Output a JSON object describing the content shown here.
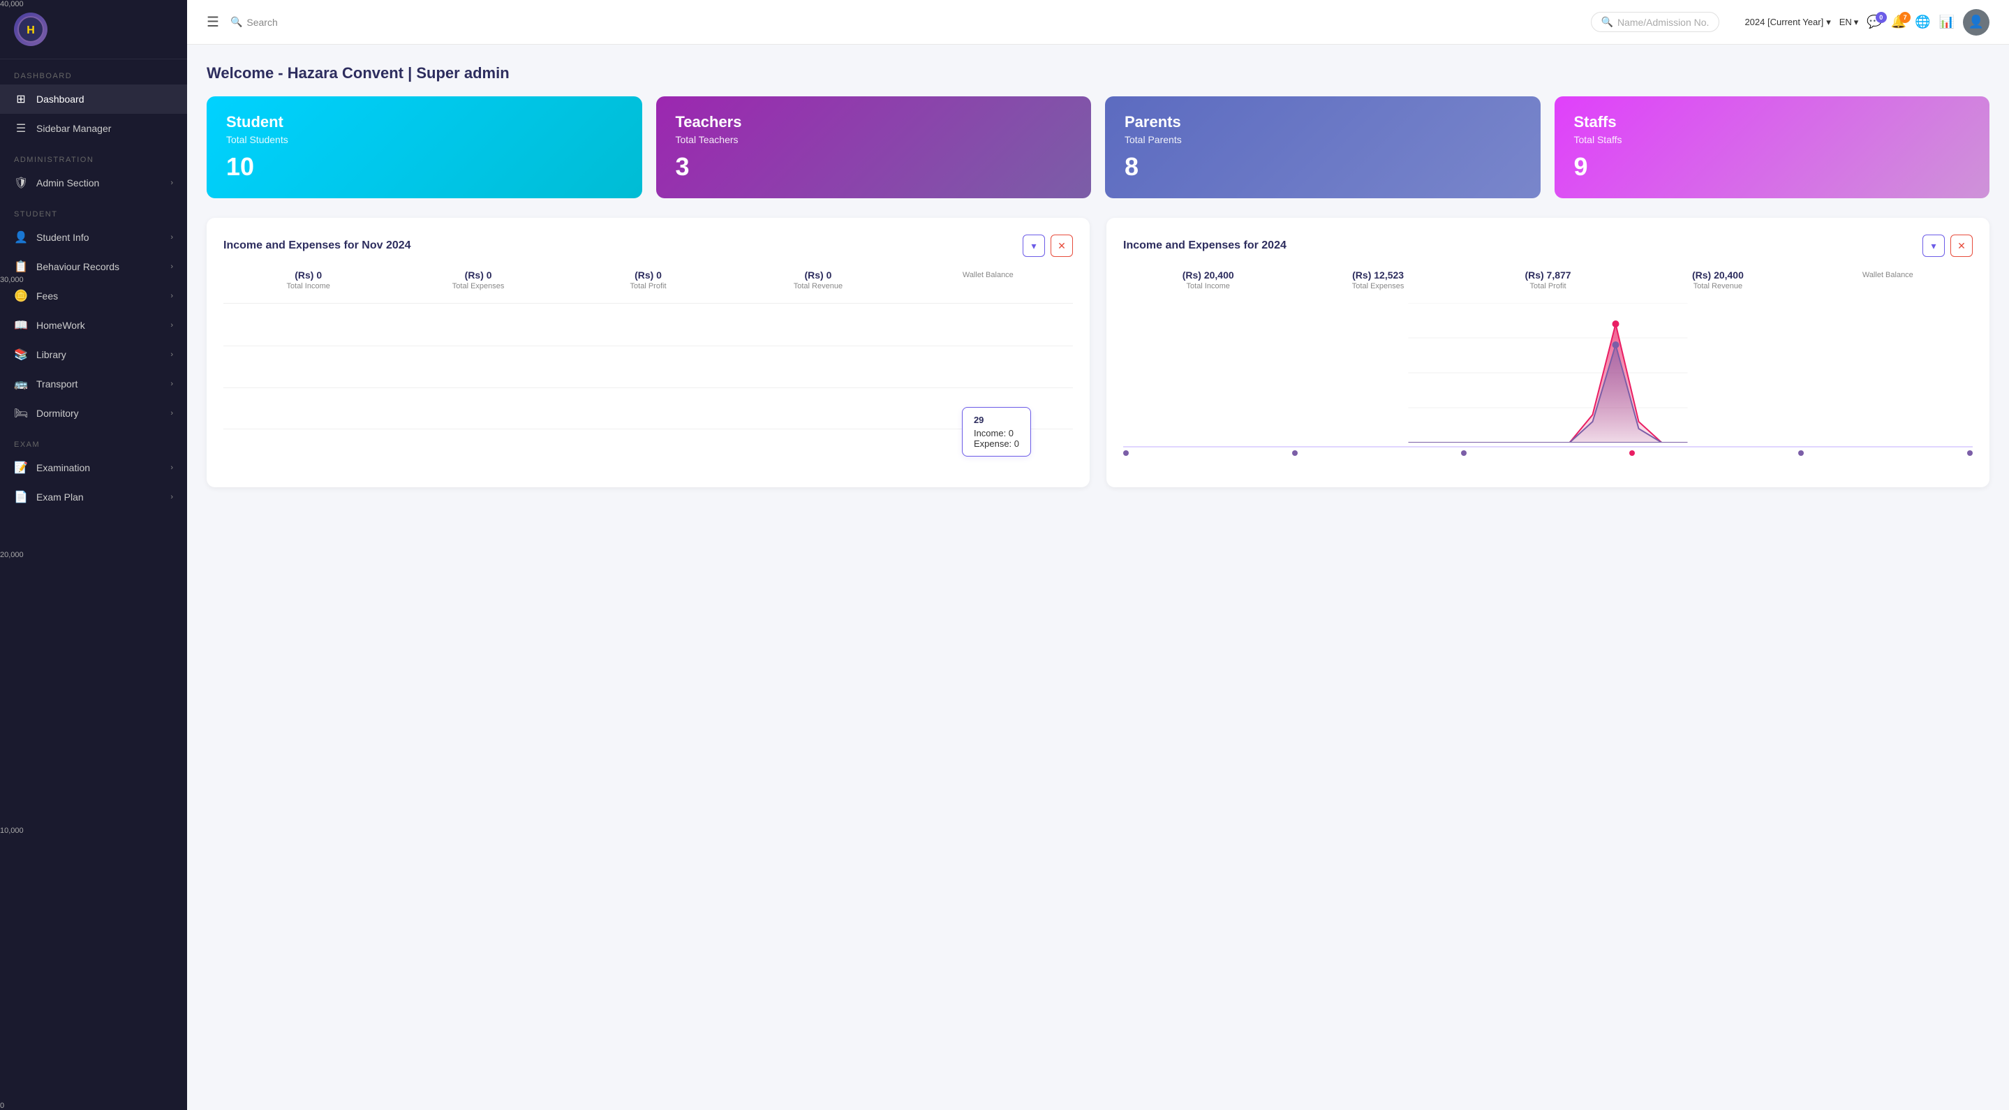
{
  "sidebar": {
    "logo_text": "H",
    "sections": [
      {
        "label": "DASHBOARD",
        "items": [
          {
            "id": "dashboard",
            "icon": "⊞",
            "label": "Dashboard",
            "active": true,
            "has_arrow": false
          },
          {
            "id": "sidebar-manager",
            "icon": "☰",
            "label": "Sidebar Manager",
            "active": false,
            "has_arrow": false
          }
        ]
      },
      {
        "label": "ADMINISTRATION",
        "items": [
          {
            "id": "admin-section",
            "icon": "🛡",
            "label": "Admin Section",
            "active": false,
            "has_arrow": true
          }
        ]
      },
      {
        "label": "STUDENT",
        "items": [
          {
            "id": "student-info",
            "icon": "👤",
            "label": "Student Info",
            "active": false,
            "has_arrow": true
          },
          {
            "id": "behaviour-records",
            "icon": "📋",
            "label": "Behaviour Records",
            "active": false,
            "has_arrow": true
          },
          {
            "id": "fees",
            "icon": "🪙",
            "label": "Fees",
            "active": false,
            "has_arrow": true
          },
          {
            "id": "homework",
            "icon": "📖",
            "label": "HomeWork",
            "active": false,
            "has_arrow": true
          },
          {
            "id": "library",
            "icon": "📚",
            "label": "Library",
            "active": false,
            "has_arrow": true
          },
          {
            "id": "transport",
            "icon": "🚌",
            "label": "Transport",
            "active": false,
            "has_arrow": true
          },
          {
            "id": "dormitory",
            "icon": "🛏",
            "label": "Dormitory",
            "active": false,
            "has_arrow": true
          }
        ]
      },
      {
        "label": "EXAM",
        "items": [
          {
            "id": "examination",
            "icon": "📝",
            "label": "Examination",
            "active": false,
            "has_arrow": true
          },
          {
            "id": "exam-plan",
            "icon": "📄",
            "label": "Exam Plan",
            "active": false,
            "has_arrow": true
          }
        ]
      }
    ]
  },
  "topbar": {
    "menu_icon": "☰",
    "search_label": "Search",
    "name_search_placeholder": "Name/Admission No.",
    "year": "2024 [Current Year]",
    "lang": "EN",
    "message_badge": "0",
    "notification_badge": "7",
    "avatar_icon": "👤"
  },
  "welcome": {
    "title": "Welcome - Hazara Convent | Super admin"
  },
  "stats": [
    {
      "id": "student",
      "card_class": "teal",
      "title": "Student",
      "subtitle": "Total Students",
      "value": "10"
    },
    {
      "id": "teachers",
      "card_class": "purple",
      "title": "Teachers",
      "subtitle": "Total Teachers",
      "value": "3"
    },
    {
      "id": "parents",
      "card_class": "blue-purple",
      "title": "Parents",
      "subtitle": "Total Parents",
      "value": "8"
    },
    {
      "id": "staffs",
      "card_class": "pink",
      "title": "Staffs",
      "subtitle": "Total Staffs",
      "value": "9"
    }
  ],
  "chart_nov": {
    "title": "Income and Expenses for Nov 2024",
    "stats": [
      {
        "label": "Total Income",
        "value": "(Rs) 0"
      },
      {
        "label": "Total Expenses",
        "value": "(Rs) 0"
      },
      {
        "label": "Total Profit",
        "value": "(Rs) 0"
      },
      {
        "label": "Total Revenue",
        "value": "(Rs) 0"
      },
      {
        "label": "Wallet Balance",
        "value": ""
      }
    ],
    "tooltip": {
      "date": "29",
      "income_label": "Income: 0",
      "expense_label": "Expense: 0"
    }
  },
  "chart_2024": {
    "title": "Income and Expenses for 2024",
    "stats": [
      {
        "label": "Total Income",
        "value": "(Rs) 20,400"
      },
      {
        "label": "Total Expenses",
        "value": "(Rs) 12,523"
      },
      {
        "label": "Total Profit",
        "value": "(Rs) 7,877"
      },
      {
        "label": "Total Revenue",
        "value": "(Rs) 20,400"
      },
      {
        "label": "Wallet Balance",
        "value": ""
      }
    ],
    "y_labels": [
      "40,000",
      "30,000",
      "20,000",
      "10,000",
      "0"
    ]
  },
  "icons": {
    "chevron_down": "▾",
    "close": "✕",
    "search": "🔍",
    "bell": "🔔",
    "message": "💬",
    "globe": "🌐",
    "chart": "📊"
  }
}
